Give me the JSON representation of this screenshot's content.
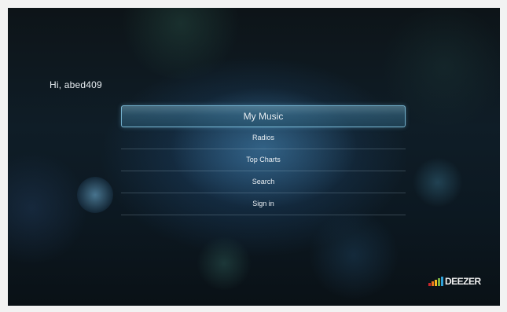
{
  "greeting": "Hi, abed409",
  "menu": {
    "items": [
      {
        "label": "My Music",
        "selected": true
      },
      {
        "label": "Radios",
        "selected": false
      },
      {
        "label": "Top Charts",
        "selected": false
      },
      {
        "label": "Search",
        "selected": false
      },
      {
        "label": "Sign in",
        "selected": false
      }
    ]
  },
  "logo": {
    "text": "DEEZER",
    "equalizer_colors": [
      "#c9262b",
      "#e8741e",
      "#f2b81f",
      "#7bb342",
      "#2fa0d8"
    ]
  }
}
